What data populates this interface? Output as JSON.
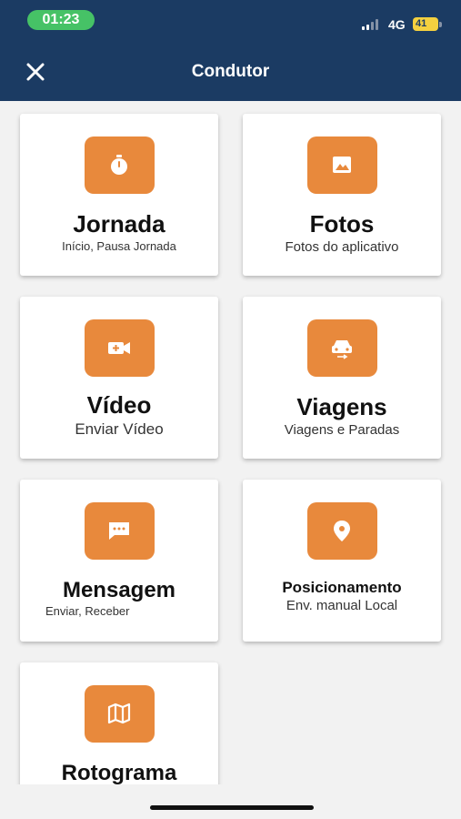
{
  "status_bar": {
    "time": "01:23",
    "network": "4G",
    "battery": "41"
  },
  "header": {
    "title": "Condutor"
  },
  "cards": [
    {
      "title": "Jornada",
      "subtitle": "Início, Pausa Jornada",
      "icon": "stopwatch-icon"
    },
    {
      "title": "Fotos",
      "subtitle": "Fotos do aplicativo",
      "icon": "image-icon"
    },
    {
      "title": "Vídeo",
      "subtitle": "Enviar Vídeo",
      "icon": "video-camera-icon"
    },
    {
      "title": "Viagens",
      "subtitle": "Viagens e Paradas",
      "icon": "car-icon"
    },
    {
      "title": "Mensagem",
      "subtitle": "Enviar, Receber",
      "icon": "message-icon"
    },
    {
      "title": "Posicionamento",
      "subtitle": "Env. manual Local",
      "icon": "location-pin-icon"
    },
    {
      "title": "Rotograma",
      "subtitle": "",
      "icon": "map-icon"
    }
  ],
  "colors": {
    "header": "#1b3b63",
    "accent": "#e8893c",
    "time_pill": "#46c266",
    "battery": "#f4d03f"
  }
}
